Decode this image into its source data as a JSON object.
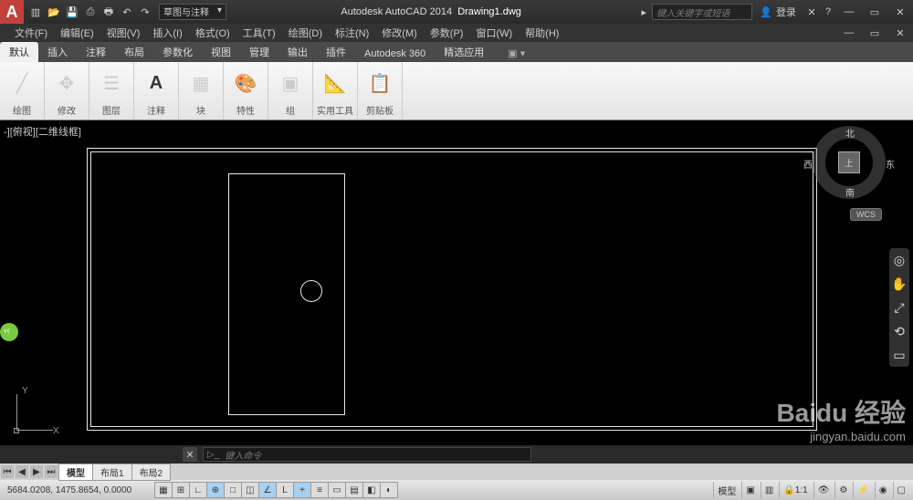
{
  "title": {
    "app": "Autodesk AutoCAD 2014",
    "file": "Drawing1.dwg"
  },
  "workspace_selector": "草图与注释",
  "search_placeholder": "键入关键字或短语",
  "login_label": "登录",
  "menus": [
    "文件(F)",
    "编辑(E)",
    "视图(V)",
    "插入(I)",
    "格式(O)",
    "工具(T)",
    "绘图(D)",
    "标注(N)",
    "修改(M)",
    "参数(P)",
    "窗口(W)",
    "帮助(H)"
  ],
  "ribbon_tabs": [
    "默认",
    "插入",
    "注释",
    "布局",
    "参数化",
    "视图",
    "管理",
    "输出",
    "插件",
    "Autodesk 360",
    "精选应用"
  ],
  "active_tab": 0,
  "panels": {
    "draw": {
      "label": "绘图"
    },
    "modify": {
      "label": "修改"
    },
    "layer": {
      "label": "图层"
    },
    "annot": {
      "label": "注释"
    },
    "block": {
      "label": "块"
    },
    "prop": {
      "label": "特性"
    },
    "group": {
      "label": "组"
    },
    "util": {
      "label": "实用工具"
    },
    "clip": {
      "label": "剪贴板"
    }
  },
  "view_label": "-][俯视][二维线框]",
  "viewcube": {
    "face": "上",
    "n": "北",
    "s": "南",
    "e": "东",
    "w": "西",
    "wcs": "WCS"
  },
  "ucs": {
    "x": "X",
    "y": "Y"
  },
  "cmd_prompt": "键入命令",
  "layout_tabs": [
    "模型",
    "布局1",
    "布局2"
  ],
  "active_layout": 0,
  "coords": "5684.0208, 1475.8654, 0.0000",
  "status_right": {
    "space": "模型",
    "scale": "1:1"
  },
  "watermark": {
    "brand": "Baidu 经验",
    "url": "jingyan.baidu.com"
  },
  "wincontrols": {
    "min": "—",
    "max": "▭",
    "close": "✕"
  }
}
